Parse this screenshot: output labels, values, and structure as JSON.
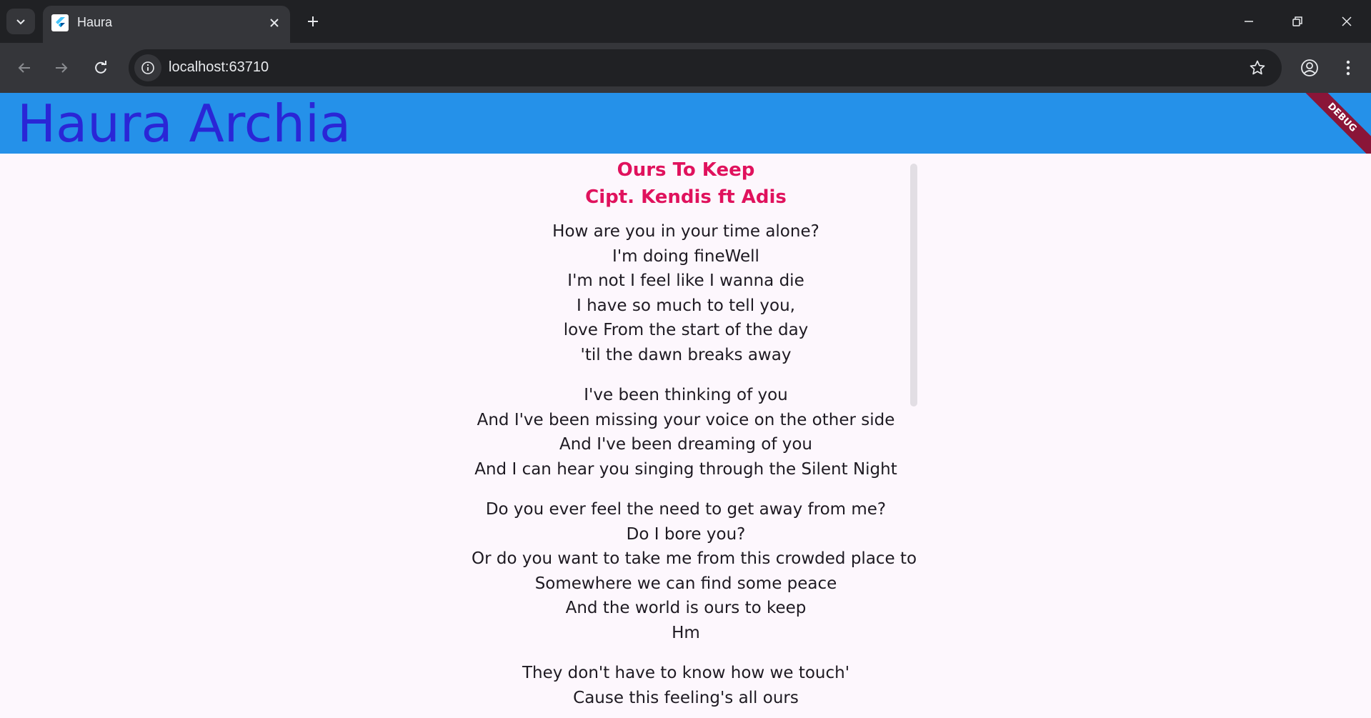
{
  "browser": {
    "tab": {
      "title": "Haura"
    },
    "address": {
      "url": "localhost:63710"
    }
  },
  "app": {
    "title": "Haura Archia",
    "debug_banner": "DEBUG"
  },
  "song": {
    "title": "Ours To Keep",
    "artist": "Cipt. Kendis ft Adis",
    "stanzas": [
      [
        "How are you in your time alone?",
        "I'm doing fineWell",
        "I'm not I feel like I wanna die",
        "I have so much to tell you,",
        "love From the start of the day",
        "'til the dawn breaks away"
      ],
      [
        "I've been thinking of you",
        "And I've been missing your voice on the other side",
        "And I've been dreaming of you",
        "And I can hear you singing through the Silent Night"
      ],
      [
        "Do you ever feel the need to get away from me?",
        "Do I bore you?",
        "Or do you want to take me from this crowded place to",
        "Somewhere we can find some peace",
        "And the world is ours to keep",
        "Hm"
      ],
      [
        "They don't have to know how we touch'",
        "Cause this feeling's all ours"
      ]
    ]
  },
  "colors": {
    "appbar": "#2591e9",
    "title": "#2a26d6",
    "song_heading": "#e0125d",
    "background": "#fdf7fd"
  }
}
